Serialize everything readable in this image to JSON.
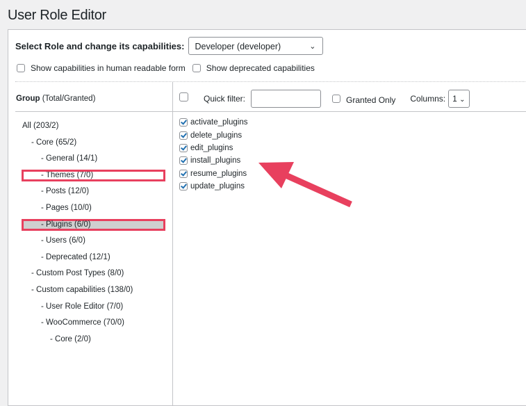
{
  "page": {
    "title": "User Role Editor"
  },
  "role": {
    "label": "Select Role and change its capabilities:",
    "selected": "Developer (developer)"
  },
  "options": [
    {
      "label": "Show capabilities in human readable form",
      "checked": false
    },
    {
      "label": "Show deprecated capabilities",
      "checked": false
    }
  ],
  "group_header": {
    "bold": "Group",
    "rest": " (Total/Granted)"
  },
  "filter": {
    "label": "Quick filter:",
    "value": "",
    "granted_only_label": "Granted Only",
    "columns_label": "Columns:",
    "columns_value": "1"
  },
  "groups": [
    {
      "label": "All (203/2)",
      "level": 0
    },
    {
      "label": "- Core (65/2)",
      "level": 1
    },
    {
      "label": "- General (14/1)",
      "level": 2
    },
    {
      "label": "- Themes (7/0)",
      "level": 2,
      "highlighted": true
    },
    {
      "label": "- Posts (12/0)",
      "level": 2
    },
    {
      "label": "- Pages (10/0)",
      "level": 2
    },
    {
      "label": "- Plugins (6/0)",
      "level": 2,
      "highlighted": true,
      "selected": true
    },
    {
      "label": "- Users (6/0)",
      "level": 2
    },
    {
      "label": "- Deprecated (12/1)",
      "level": 2
    },
    {
      "label": "- Custom Post Types (8/0)",
      "level": 1
    },
    {
      "label": "- Custom capabilities (138/0)",
      "level": 1
    },
    {
      "label": "- User Role Editor (7/0)",
      "level": 2
    },
    {
      "label": "- WooCommerce (70/0)",
      "level": 2
    },
    {
      "label": "- Core (2/0)",
      "level": 3
    }
  ],
  "capabilities": [
    {
      "name": "activate_plugins",
      "checked": true
    },
    {
      "name": "delete_plugins",
      "checked": true
    },
    {
      "name": "edit_plugins",
      "checked": true
    },
    {
      "name": "install_plugins",
      "checked": true
    },
    {
      "name": "resume_plugins",
      "checked": true
    },
    {
      "name": "update_plugins",
      "checked": true
    }
  ],
  "annotation": {
    "color": "#e8405e",
    "shape": "arrow"
  }
}
